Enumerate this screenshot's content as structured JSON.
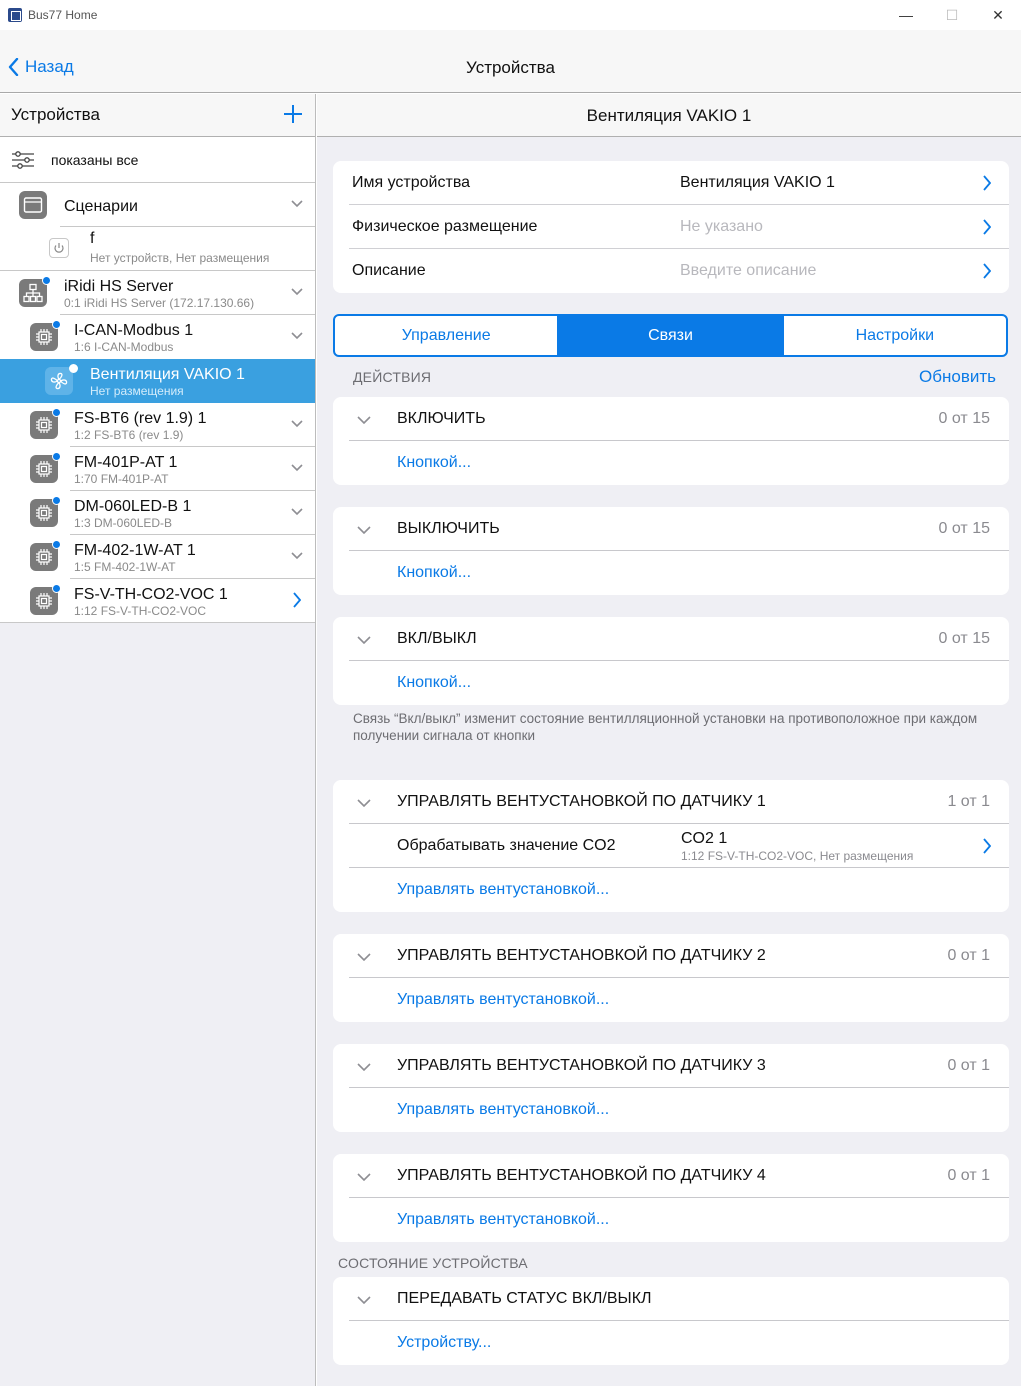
{
  "window": {
    "title": "Bus77 Home",
    "minimize": "—",
    "maximize": "☐",
    "close": "✕"
  },
  "nav": {
    "back_label": "Назад",
    "title": "Устройства"
  },
  "sidebar": {
    "title": "Устройства",
    "filter_label": "показаны все",
    "items": [
      {
        "title": "Сценарии",
        "subtitle": ""
      },
      {
        "title": "f",
        "subtitle": "Нет устройств, Нет размещения"
      },
      {
        "title": "iRidi HS Server",
        "subtitle": "0:1 iRidi HS Server (172.17.130.66)"
      },
      {
        "title": "I-CAN-Modbus 1",
        "subtitle": "1:6 I-CAN-Modbus"
      },
      {
        "title": "Вентиляция VAKIO 1",
        "subtitle": "Нет размещения"
      },
      {
        "title": "FS-BT6 (rev 1.9) 1",
        "subtitle": "1:2 FS-BT6 (rev 1.9)"
      },
      {
        "title": "FM-401P-AT 1",
        "subtitle": "1:70 FM-401P-AT"
      },
      {
        "title": "DM-060LED-B 1",
        "subtitle": "1:3 DM-060LED-B"
      },
      {
        "title": "FM-402-1W-AT 1",
        "subtitle": "1:5 FM-402-1W-AT"
      },
      {
        "title": "FS-V-TH-CO2-VOC 1",
        "subtitle": "1:12 FS-V-TH-CO2-VOC"
      }
    ]
  },
  "detail": {
    "title": "Вентиляция VAKIO 1",
    "props": [
      {
        "label": "Имя устройства",
        "value": "Вентиляция VAKIO 1"
      },
      {
        "label": "Физическое размещение",
        "value": "Не указано"
      },
      {
        "label": "Описание",
        "value": "Введите описание"
      }
    ],
    "tabs": [
      "Управление",
      "Связи",
      "Настройки"
    ],
    "actions_label": "ДЕЙСТВИЯ",
    "refresh_label": "Обновить",
    "actions": [
      {
        "name": "ВКЛЮЧИТЬ",
        "count": "0 от 15",
        "link": "Кнопкой..."
      },
      {
        "name": "ВЫКЛЮЧИТЬ",
        "count": "0 от 15",
        "link": "Кнопкой..."
      },
      {
        "name": "ВКЛ/ВЫКЛ",
        "count": "0 от 15",
        "link": "Кнопкой..."
      }
    ],
    "note": "Связь “Вкл/выкл” изменит состояние вентилляционной установки на противоположное при каждом получении сигнала от кнопки",
    "sensors": [
      {
        "name": "УПРАВЛЯТЬ ВЕНТУСТАНОВКОЙ ПО ДАТЧИКУ 1",
        "count": "1 от 1",
        "link": "Управлять вентустановкой...",
        "binding": {
          "label": "Обрабатывать значение CO2",
          "value": "CO2 1",
          "subvalue": "1:12 FS-V-TH-CO2-VOC, Нет размещения"
        }
      },
      {
        "name": "УПРАВЛЯТЬ ВЕНТУСТАНОВКОЙ ПО ДАТЧИКУ 2",
        "count": "0 от 1",
        "link": "Управлять вентустановкой..."
      },
      {
        "name": "УПРАВЛЯТЬ ВЕНТУСТАНОВКОЙ ПО ДАТЧИКУ 3",
        "count": "0 от 1",
        "link": "Управлять вентустановкой..."
      },
      {
        "name": "УПРАВЛЯТЬ ВЕНТУСТАНОВКОЙ ПО ДАТЧИКУ 4",
        "count": "0 от 1",
        "link": "Управлять вентустановкой..."
      }
    ],
    "state_label": "СОСТОЯНИЕ УСТРОЙСТВА",
    "state_action": {
      "name": "ПЕРЕДАВАТЬ СТАТУС ВКЛ/ВЫКЛ",
      "link": "Устройству..."
    }
  },
  "colors": {
    "accent": "#0a7ae6",
    "selected_row": "#3aa0e0",
    "background": "#efeff4"
  },
  "icons": {
    "back": "chevron-left-icon",
    "add": "plus-icon",
    "filter": "sliders-icon",
    "folder": "folder-icon",
    "power": "power-icon",
    "server": "network-icon",
    "chip": "chip-icon",
    "fan": "fan-icon"
  }
}
